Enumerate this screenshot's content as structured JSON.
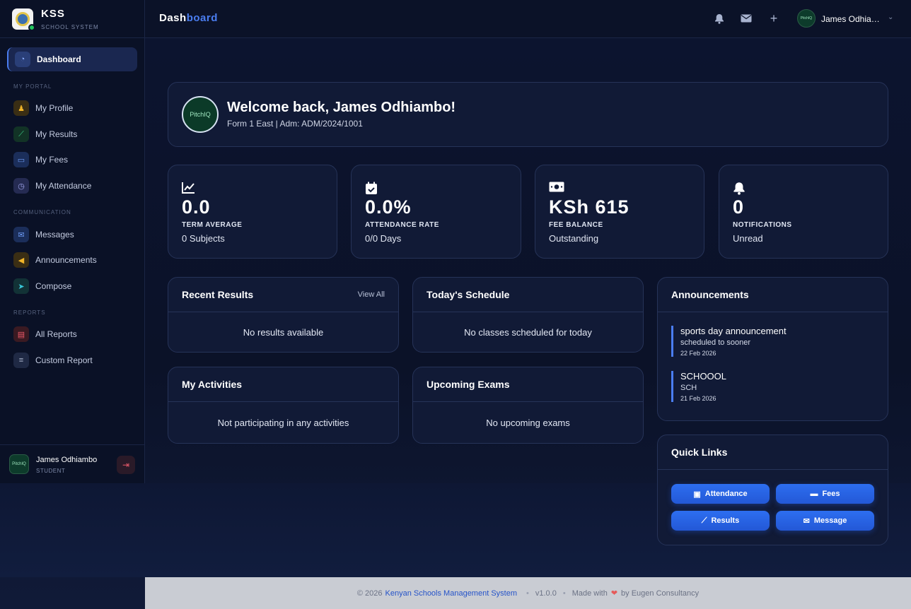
{
  "brand": {
    "name": "KSS",
    "subtitle": "SCHOOL SYSTEM"
  },
  "sidebar": {
    "active": {
      "label": "Dashboard",
      "icon": "gauge-icon"
    },
    "sections": [
      {
        "title": "MY PORTAL",
        "items": [
          {
            "label": "My Profile",
            "icon": "user-graduate-icon"
          },
          {
            "label": "My Results",
            "icon": "chart-line-icon"
          },
          {
            "label": "My Fees",
            "icon": "wallet-icon"
          },
          {
            "label": "My Attendance",
            "icon": "clock-icon"
          }
        ]
      },
      {
        "title": "COMMUNICATION",
        "items": [
          {
            "label": "Messages",
            "icon": "envelope-icon"
          },
          {
            "label": "Announcements",
            "icon": "megaphone-icon"
          },
          {
            "label": "Compose",
            "icon": "paper-plane-icon"
          }
        ]
      },
      {
        "title": "REPORTS",
        "items": [
          {
            "label": "All Reports",
            "icon": "pdf-file-icon"
          },
          {
            "label": "Custom Report",
            "icon": "sliders-icon"
          }
        ]
      }
    ],
    "user": {
      "name": "James Odhiambo",
      "role": "STUDENT",
      "avatar_text": "PitchIQ"
    }
  },
  "header": {
    "title_part1": "Dash",
    "title_part2": "board",
    "user_name": "James Odhiambo",
    "avatar_text": "PitchIQ"
  },
  "welcome": {
    "title": "Welcome back, James Odhiambo!",
    "subtitle": "Form 1 East | Adm: ADM/2024/1001",
    "avatar_text": "PitchIQ"
  },
  "stats": [
    {
      "icon": "chart-line-icon",
      "value": "0.0",
      "label": "TERM AVERAGE",
      "sub": "0 Subjects"
    },
    {
      "icon": "calendar-check-icon",
      "value": "0.0%",
      "label": "ATTENDANCE RATE",
      "sub": "0/0 Days"
    },
    {
      "icon": "money-bill-icon",
      "value": "KSh 615",
      "label": "FEE BALANCE",
      "sub": "Outstanding"
    },
    {
      "icon": "bell-icon",
      "value": "0",
      "label": "NOTIFICATIONS",
      "sub": "Unread"
    }
  ],
  "panels": {
    "recent_results": {
      "title": "Recent Results",
      "link": "View All",
      "empty": "No results available"
    },
    "schedule": {
      "title": "Today's Schedule",
      "empty": "No classes scheduled for today"
    },
    "activities": {
      "title": "My Activities",
      "empty": "Not participating in any activities"
    },
    "exams": {
      "title": "Upcoming Exams",
      "empty": "No upcoming exams"
    }
  },
  "announcements": {
    "title": "Announcements",
    "items": [
      {
        "title": "sports day announcement",
        "body": "scheduled to sooner",
        "date": "22 Feb 2026"
      },
      {
        "title": "SCHOOOL",
        "body": "SCH",
        "date": "21 Feb 2026"
      }
    ]
  },
  "quick_links": {
    "title": "Quick Links",
    "buttons": [
      {
        "label": "Attendance",
        "icon": "calendar-check-icon"
      },
      {
        "label": "Fees",
        "icon": "money-bill-icon"
      },
      {
        "label": "Results",
        "icon": "chart-line-icon"
      },
      {
        "label": "Message",
        "icon": "envelope-icon"
      }
    ]
  },
  "footer": {
    "copyright": "© 2026",
    "org": "Kenyan Schools Management System",
    "version": "v1.0.0",
    "made_with": "Made with",
    "by": "by Eugen Consultancy"
  },
  "colors": {
    "accent": "#4a7df0",
    "background": "#0b1228",
    "card": "#111a36",
    "button": "#2d6ef0"
  }
}
